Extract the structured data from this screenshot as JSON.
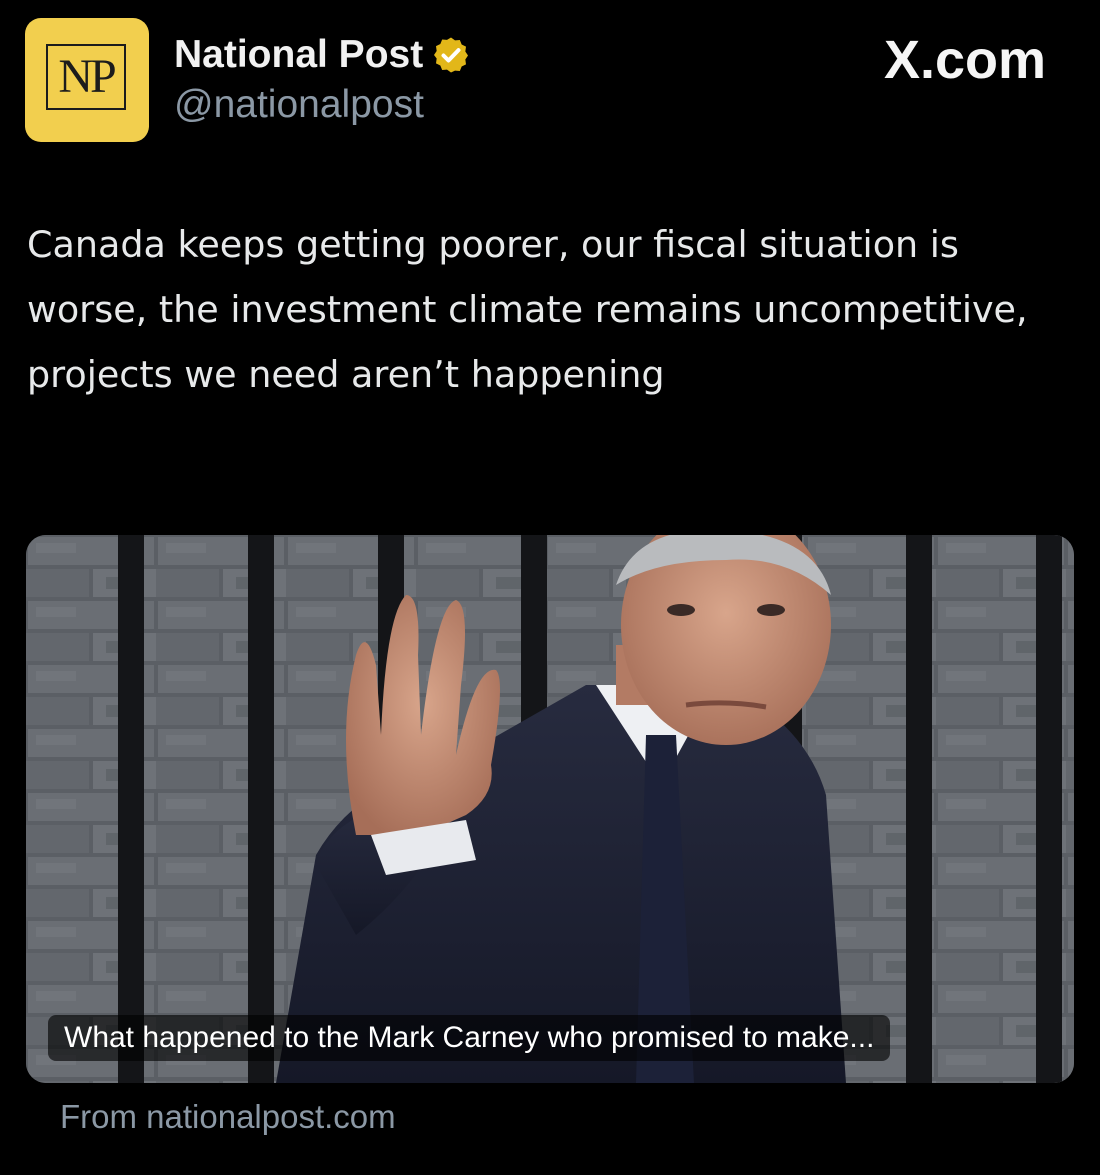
{
  "account": {
    "avatar_text": "NP",
    "display_name": "National Post",
    "handle": "@nationalpost",
    "verified_badge": "verified-badge-icon",
    "avatar_color": "#f2cf4e",
    "badge_color": "#e2b719"
  },
  "site_mark": "X.com",
  "tweet": {
    "text": "Canada keeps getting poorer, our fiscal situation is worse, the investment climate remains uncompetitive, projects we need aren’t happening"
  },
  "link_card": {
    "image": "photo of man waving in front of brick wall with black railings",
    "caption": "What happened to the Mark Carney who promised to make...",
    "source": "From nationalpost.com"
  },
  "colors": {
    "background": "#000000",
    "primary_text": "#e7e9ea",
    "secondary_text": "#8b98a5"
  }
}
